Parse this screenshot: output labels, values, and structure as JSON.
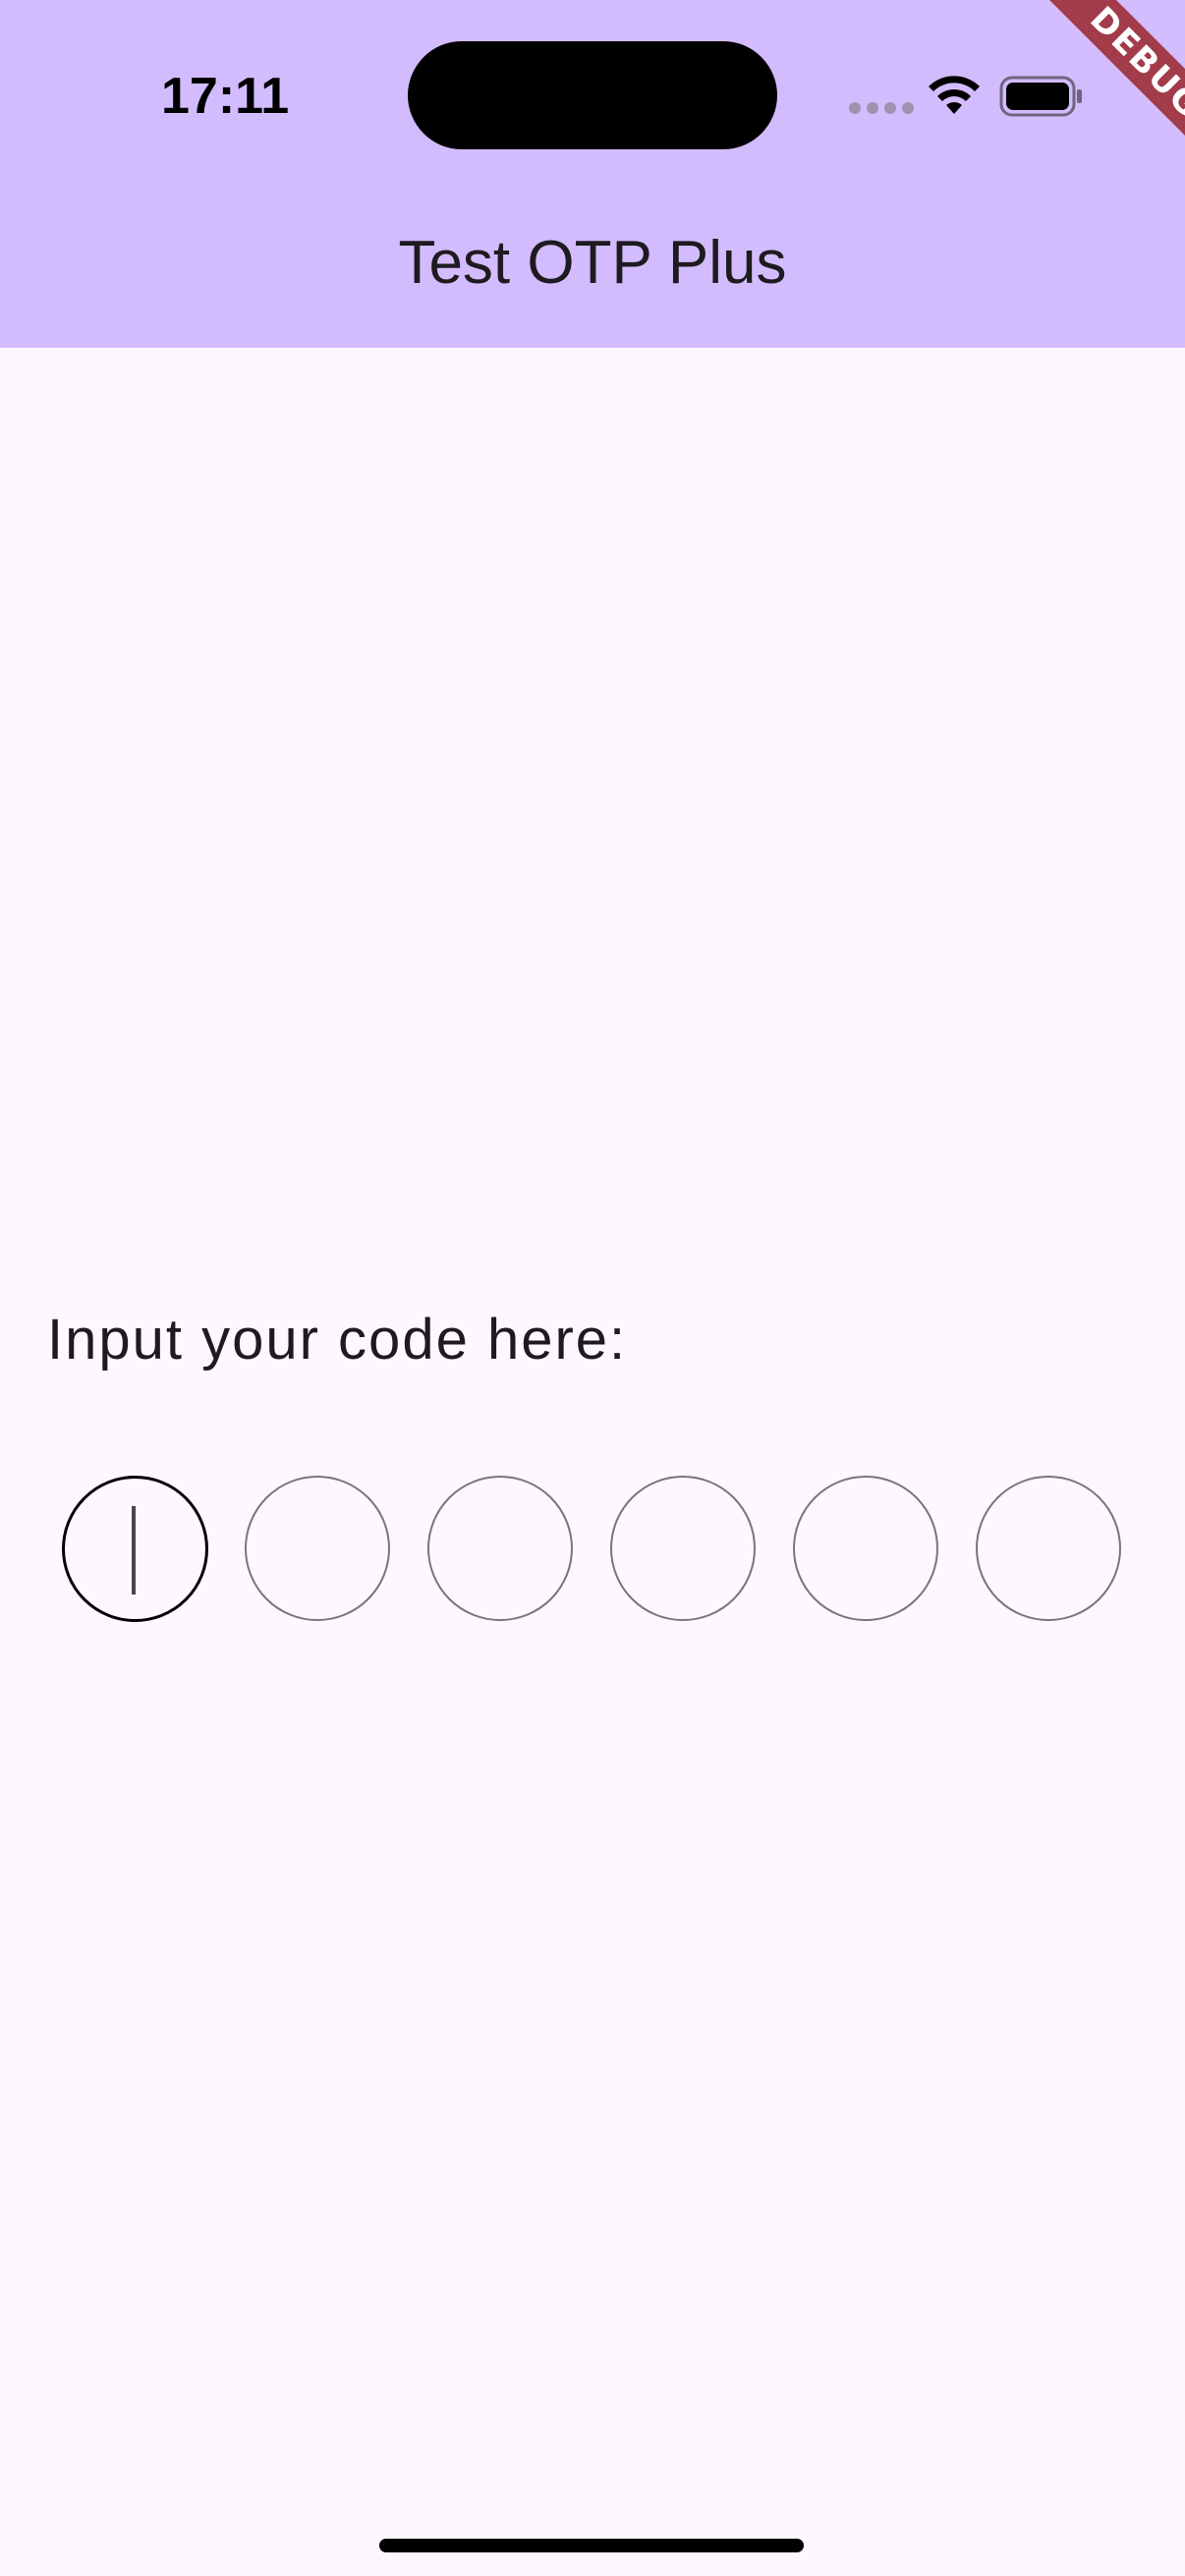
{
  "status_bar": {
    "time": "17:11"
  },
  "app_bar": {
    "title": "Test OTP Plus"
  },
  "debug_banner": {
    "label": "DEBUG"
  },
  "otp": {
    "prompt": "Input your code here:",
    "cells": [
      "",
      "",
      "",
      "",
      "",
      ""
    ],
    "focused_index": 0
  },
  "colors": {
    "app_bar_bg": "#D3BCFD",
    "page_bg": "#FEF7FF",
    "debug_ribbon": "#A23B4A",
    "cell_border": "#777480",
    "focused_border": "#000000"
  }
}
